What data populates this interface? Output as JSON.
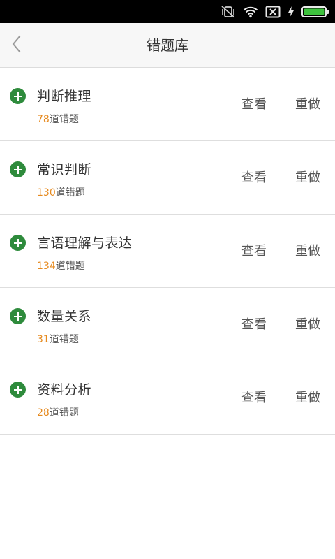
{
  "status_bar": {
    "icons": [
      "mute-vibrate-icon",
      "wifi-icon",
      "no-sim-icon",
      "charging-icon",
      "battery-icon"
    ],
    "battery_level": 1.0,
    "battery_color": "#3ec23e"
  },
  "header": {
    "title": "错题库",
    "back_icon": "chevron-left-icon"
  },
  "colors": {
    "accent_green": "#2e8b3c",
    "count_orange": "#e68a1f"
  },
  "categories": [
    {
      "name": "判断推理",
      "count": "78",
      "suffix": "道错题",
      "view_label": "查看",
      "redo_label": "重做"
    },
    {
      "name": "常识判断",
      "count": "130",
      "suffix": "道错题",
      "view_label": "查看",
      "redo_label": "重做"
    },
    {
      "name": "言语理解与表达",
      "count": "134",
      "suffix": "道错题",
      "view_label": "查看",
      "redo_label": "重做"
    },
    {
      "name": "数量关系",
      "count": "31",
      "suffix": "道错题",
      "view_label": "查看",
      "redo_label": "重做"
    },
    {
      "name": "资料分析",
      "count": "28",
      "suffix": "道错题",
      "view_label": "查看",
      "redo_label": "重做"
    }
  ]
}
